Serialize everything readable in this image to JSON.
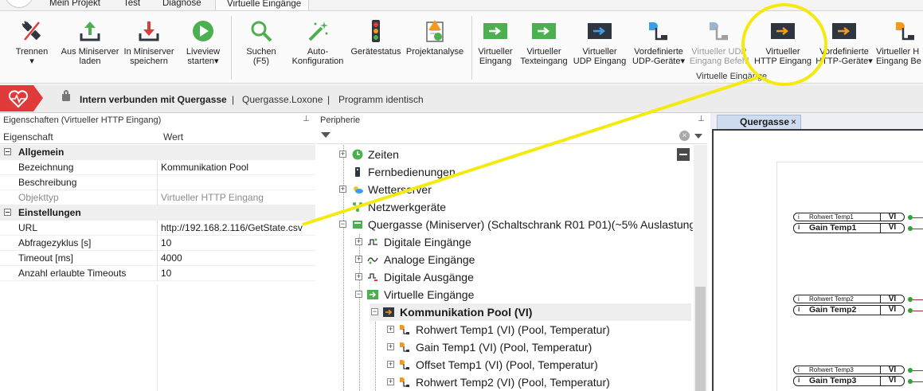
{
  "ribbon": {
    "tabs": [
      "Mein Projekt",
      "Test",
      "Diagnose",
      "Virtuelle Eingänge"
    ],
    "active_tab": "Virtuelle Eingänge",
    "buttons": [
      {
        "label1": "Trennen",
        "label2": "▾",
        "icon": "disconnect-plug-icon"
      },
      {
        "label1": "Aus Miniserver",
        "label2": "laden",
        "icon": "upload-icon"
      },
      {
        "label1": "In Miniserver",
        "label2": "speichern",
        "icon": "download-icon"
      },
      {
        "label1": "Liveview",
        "label2": "starten▾",
        "icon": "play-icon"
      },
      {
        "label1": "Suchen",
        "label2": "(F5)",
        "icon": "search-icon"
      },
      {
        "label1": "Auto-",
        "label2": "Konfiguration",
        "icon": "magic-wand-icon"
      },
      {
        "label1": "Gerätestatus",
        "label2": "",
        "icon": "traffic-light-icon"
      },
      {
        "label1": "Projektanalyse",
        "label2": "",
        "icon": "report-warning-icon"
      },
      {
        "label1": "Virtueller",
        "label2": "Eingang",
        "icon": "virtual-input-icon"
      },
      {
        "label1": "Virtueller",
        "label2": "Texteingang",
        "icon": "virtual-text-input-icon"
      },
      {
        "label1": "Virtueller",
        "label2": "UDP Eingang",
        "icon": "udp-input-icon"
      },
      {
        "label1": "Vordefinierte",
        "label2": "UDP-Geräte▾",
        "icon": "udp-device-icon"
      },
      {
        "label1": "Virtueller UDP",
        "label2": "Eingang Befehl",
        "icon": "udp-command-icon"
      },
      {
        "label1": "Virtueller",
        "label2": "HTTP Eingang",
        "icon": "http-input-icon"
      },
      {
        "label1": "Vordefinierte",
        "label2": "HTTP-Geräte▾",
        "icon": "http-device-icon"
      },
      {
        "label1": "Virtueller H",
        "label2": "Eingang Be",
        "icon": "http-command-icon"
      }
    ],
    "group_label": "Virtuelle Eingänge"
  },
  "status": {
    "connection": "Intern verbunden mit Quergasse",
    "project": "Quergasse.Loxone",
    "program": "Programm identisch",
    "sep": "|"
  },
  "properties": {
    "title": "Eigenschaften (Virtueller HTTP Eingang)",
    "col_property": "Eigenschaft",
    "col_value": "Wert",
    "rows": [
      {
        "type": "cat",
        "key": "Allgemein",
        "value": ""
      },
      {
        "type": "row",
        "key": "Bezeichnung",
        "value": "Kommunikation Pool"
      },
      {
        "type": "row",
        "key": "Beschreibung",
        "value": ""
      },
      {
        "type": "muted",
        "key": "Objekttyp",
        "value": "Virtueller HTTP Eingang"
      },
      {
        "type": "cat",
        "key": "Einstellungen",
        "value": ""
      },
      {
        "type": "row",
        "key": "URL",
        "value": "http://192.168.2.116/GetState.csv"
      },
      {
        "type": "row",
        "key": "Abfragezyklus [s]",
        "value": "10"
      },
      {
        "type": "row",
        "key": "Timeout [ms]",
        "value": "4000"
      },
      {
        "type": "row",
        "key": "Anzahl erlaubte Timeouts",
        "value": "10"
      }
    ]
  },
  "peripherie": {
    "title": "Peripherie",
    "items": [
      {
        "label": "Zeiten",
        "icon": "clock-icon"
      },
      {
        "label": "Fernbedienungen",
        "icon": "remote-icon"
      },
      {
        "label": "Wetterserver",
        "icon": "weather-icon"
      },
      {
        "label": "Netzwerkgeräte",
        "icon": "network-icon"
      },
      {
        "label": "Quergasse (Miniserver) (Schaltschrank R01 P01)(~5% Auslastung)",
        "icon": "miniserver-icon"
      },
      {
        "label": "Digitale Eingänge",
        "icon": "digital-input-icon"
      },
      {
        "label": "Analoge Eingänge",
        "icon": "analog-input-icon"
      },
      {
        "label": "Digitale Ausgänge",
        "icon": "digital-output-icon"
      },
      {
        "label": "Virtuelle Eingänge",
        "icon": "virtual-input-icon"
      },
      {
        "label": "Kommunikation Pool (VI)",
        "icon": "http-input-icon"
      },
      {
        "label": "Rohwert Temp1 (VI) (Pool, Temperatur)",
        "icon": "vi-command-icon"
      },
      {
        "label": "Gain Temp1 (VI) (Pool, Temperatur)",
        "icon": "vi-command-icon"
      },
      {
        "label": "Offset Temp1 (VI) (Pool, Temperatur)",
        "icon": "vi-command-icon"
      },
      {
        "label": "Rohwert Temp2 (VI) (Pool, Temperatur)",
        "icon": "vi-command-icon"
      }
    ],
    "clear_glyph": "×"
  },
  "document": {
    "tab_label": "Quergasse",
    "close_glyph": "×",
    "blocks": [
      {
        "info": "i",
        "name": "Rohwert Temp1",
        "vi": "VI"
      },
      {
        "info": "i",
        "name": "Gain Temp1",
        "vi": "VI"
      },
      {
        "info": "i",
        "name": "Rohwert Temp2",
        "vi": "VI"
      },
      {
        "info": "i",
        "name": "Gain Temp2",
        "vi": "VI"
      },
      {
        "info": "i",
        "name": "Rohwert Temp3",
        "vi": "VI"
      },
      {
        "info": "i",
        "name": "Gain Temp3",
        "vi": "VI"
      }
    ]
  },
  "annotation": {
    "color": "#f5ea10"
  },
  "colors": {
    "accent_green": "#4caf50",
    "accent_orange": "#f39a1e",
    "dark_icon": "#2f3640",
    "badge_red": "#e03a3a",
    "highlight_yellow": "#f5ea10"
  }
}
